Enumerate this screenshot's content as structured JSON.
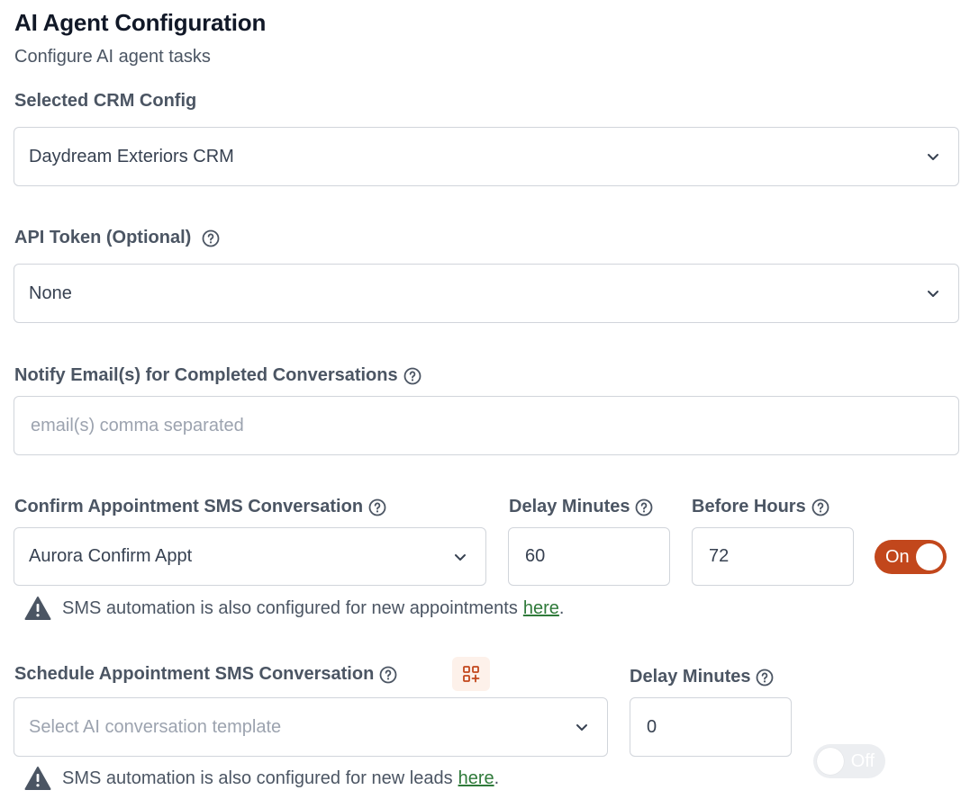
{
  "header": {
    "title": "AI Agent Configuration",
    "subtitle": "Configure AI agent tasks"
  },
  "crm": {
    "label": "Selected CRM Config",
    "value": "Daydream Exteriors CRM"
  },
  "api_token": {
    "label": "API Token (Optional)",
    "value": "None"
  },
  "notify": {
    "label": "Notify Email(s) for Completed Conversations",
    "placeholder": "email(s) comma separated"
  },
  "confirm": {
    "label": "Confirm Appointment SMS Conversation",
    "value": "Aurora Confirm Appt",
    "delay_label": "Delay Minutes",
    "delay_value": "60",
    "before_label": "Before Hours",
    "before_value": "72",
    "toggle_label": "On",
    "warning_text": "SMS automation is also configured for new appointments",
    "warning_link": "here",
    "warning_end": "."
  },
  "schedule": {
    "label": "Schedule Appointment SMS Conversation",
    "placeholder": "Select AI conversation template",
    "delay_label": "Delay Minutes",
    "delay_value": "0",
    "toggle_label": "Off",
    "warning_text": "SMS automation is also configured for new leads",
    "warning_link": "here",
    "warning_end": "."
  },
  "colors": {
    "accent": "#c2471c",
    "link": "#2f7a3a"
  }
}
